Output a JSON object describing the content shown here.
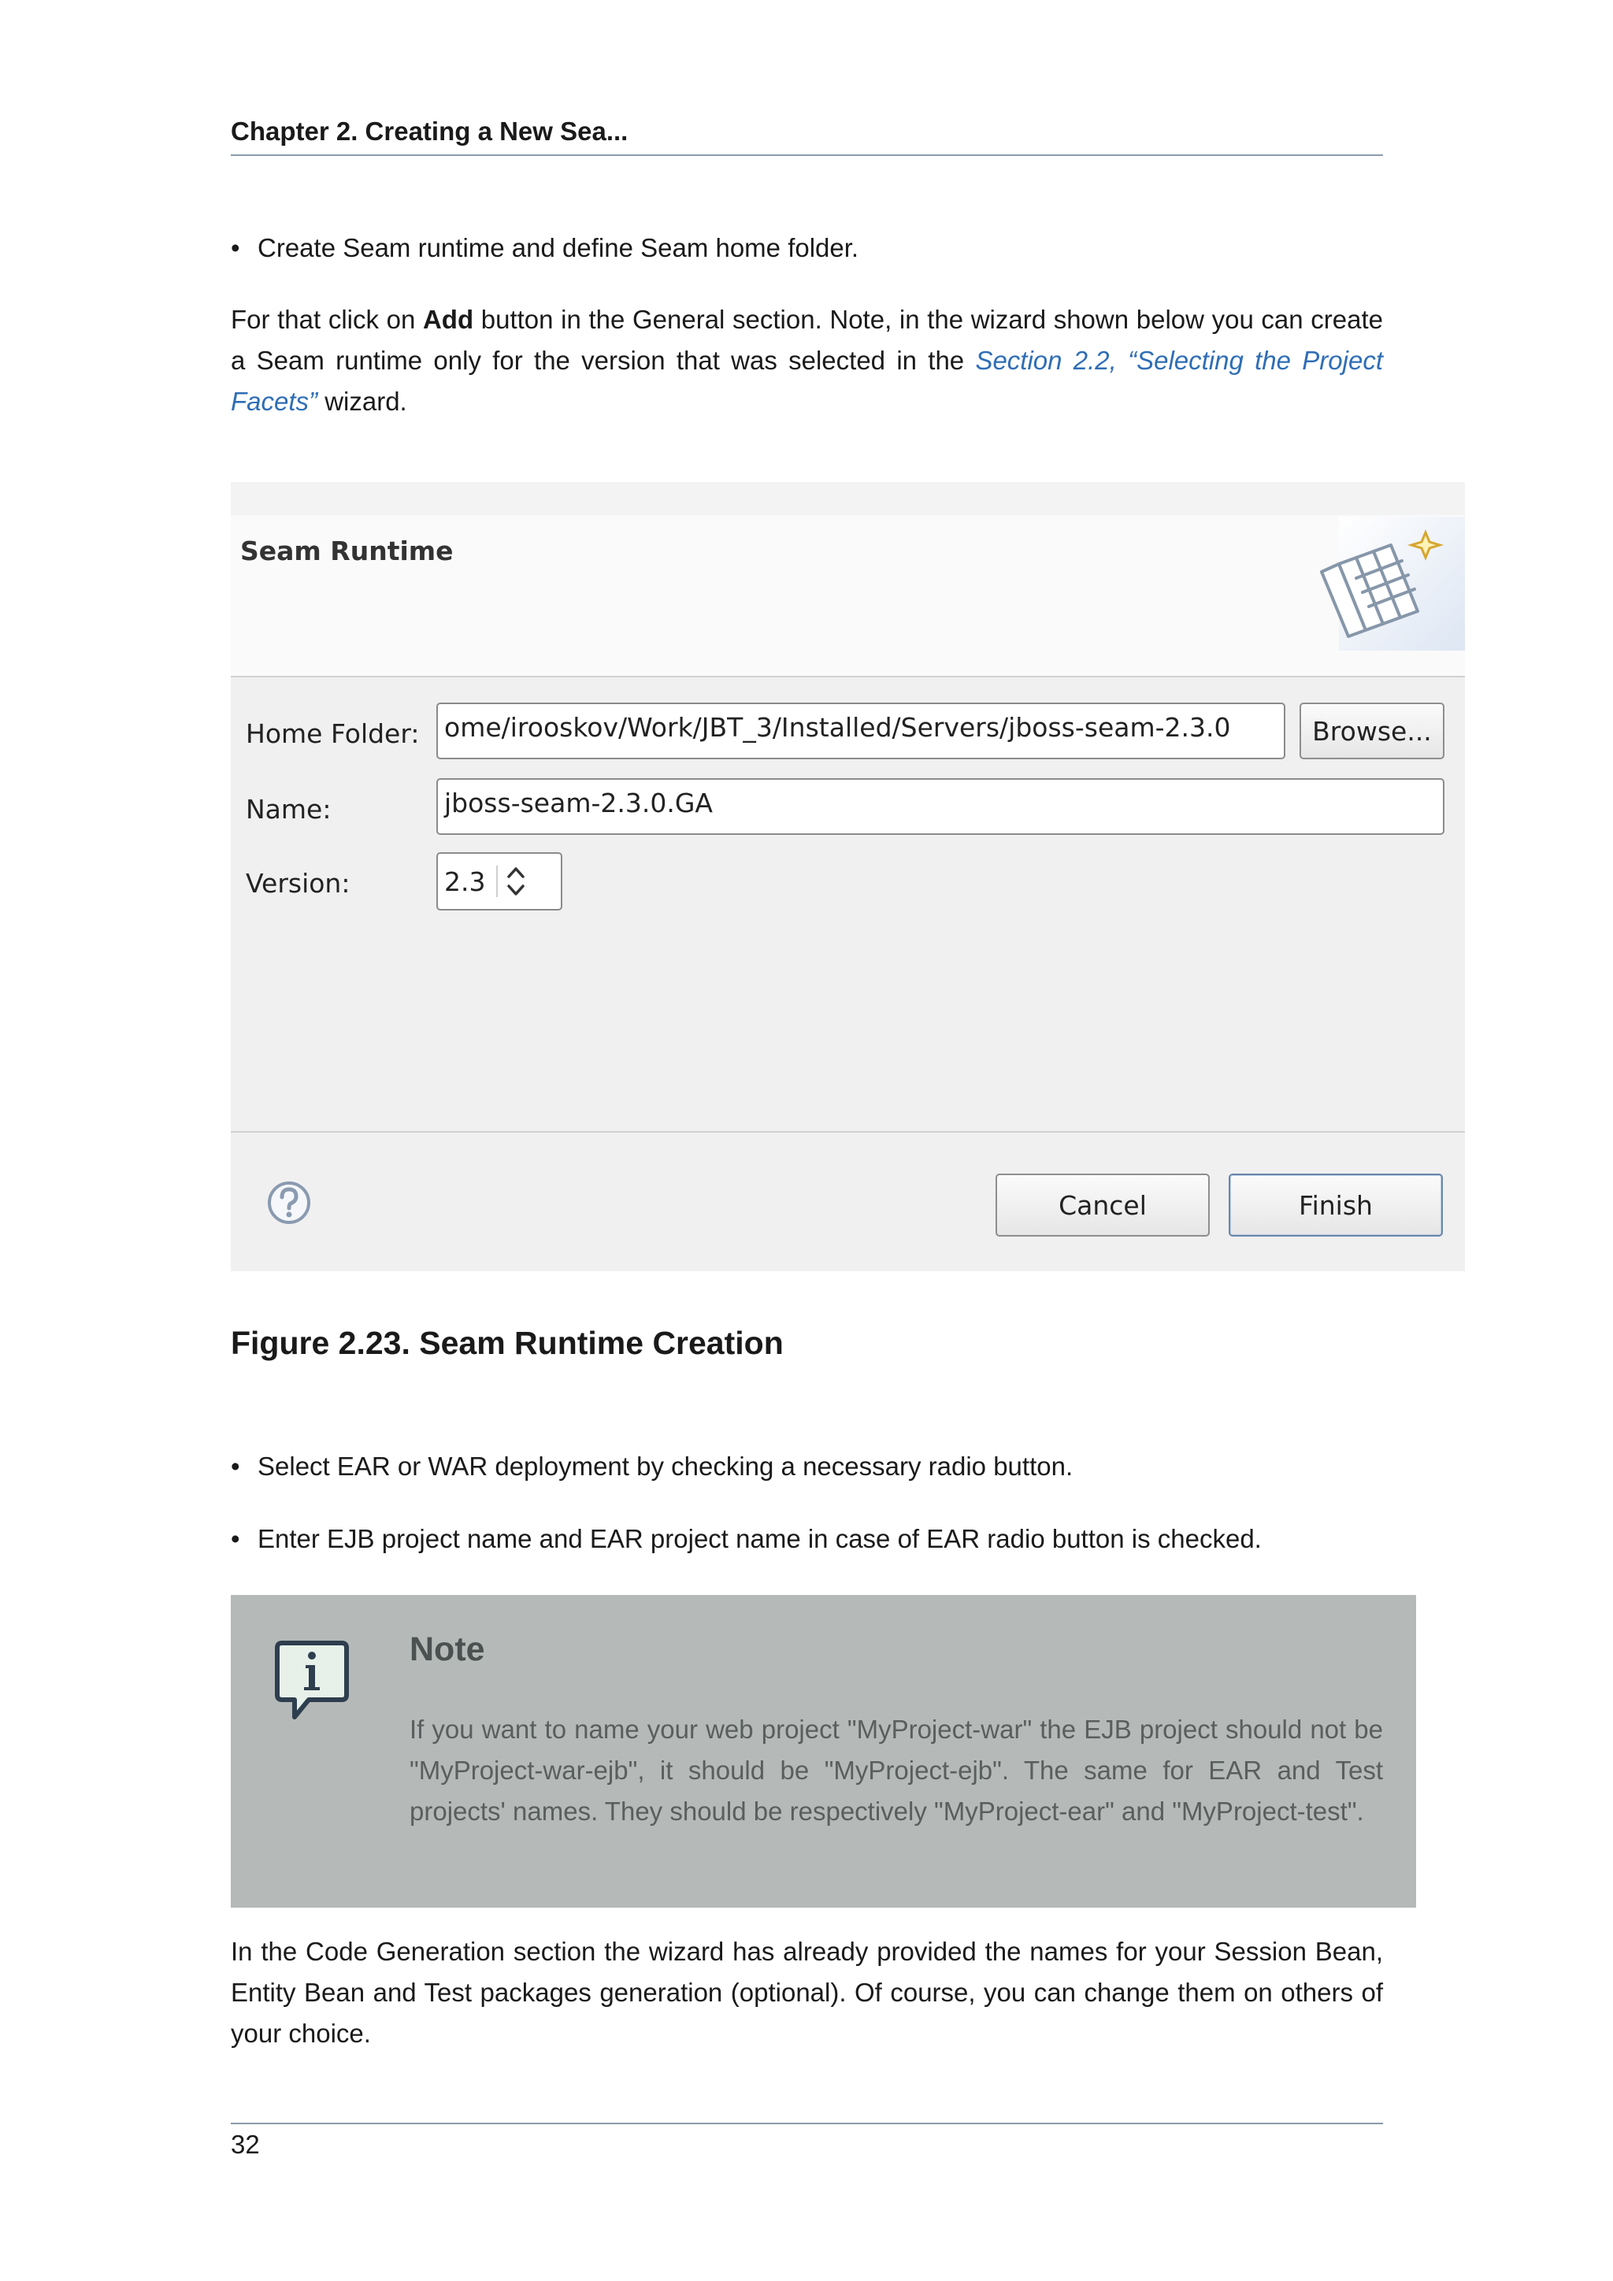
{
  "header": {
    "chapter": "Chapter 2. Creating a New Sea..."
  },
  "bullets_top": [
    "Create Seam runtime and define Seam home folder."
  ],
  "intro": {
    "pre_bold": "For that click on ",
    "bold": "Add",
    "mid": " button in the General section. Note, in the wizard shown below you can create a Seam runtime only for the version that was selected in the ",
    "link": "Section 2.2, “Selecting the Project Facets”",
    "post": " wizard."
  },
  "dialog": {
    "title": "Seam Runtime",
    "home_folder_label": "Home Folder:",
    "home_folder_value": "ome/irooskov/Work/JBT_3/Installed/Servers/jboss-seam-2.3.0",
    "browse_label": "Browse...",
    "name_label": "Name:",
    "name_value": "jboss-seam-2.3.0.GA",
    "version_label": "Version:",
    "version_value": "2.3",
    "cancel_label": "Cancel",
    "finish_label": "Finish",
    "help_icon": "question-circle-icon",
    "banner_icon": "seam-runtime-wizard-icon"
  },
  "figure_caption": "Figure 2.23. Seam Runtime Creation",
  "bullets_bottom": [
    "Select EAR or WAR deployment by checking a necessary radio button.",
    "Enter EJB project name and EAR project name in case of EAR radio button is checked."
  ],
  "note": {
    "icon": "info-icon",
    "title": "Note",
    "text": "If you want to name your web project \"MyProject-war\" the EJB project should not be \"MyProject-war-ejb\", it should be \"MyProject-ejb\". The same for EAR and Test projects' names. They should be respectively \"MyProject-ear\" and \"MyProject-test\"."
  },
  "closing_paragraph": "In the Code Generation section the wizard has already provided the names for your Session Bean, Entity Bean and Test packages generation (optional). Of course, you can change them on others of your choice.",
  "footer": {
    "page_number": "32"
  }
}
